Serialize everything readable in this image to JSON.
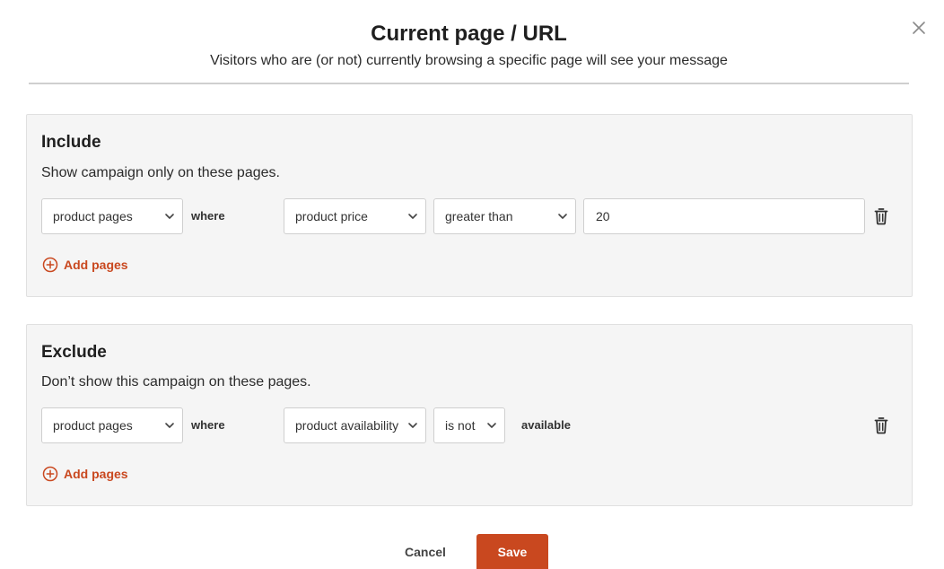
{
  "dialog": {
    "title": "Current page / URL",
    "subtitle": "Visitors who are (or not) currently browsing a specific page will see your message"
  },
  "include": {
    "title": "Include",
    "description": "Show campaign only on these pages.",
    "rule": {
      "page_type": "product pages",
      "where_label": "where",
      "attribute": "product price",
      "operator": "greater than",
      "value": "20"
    },
    "add_label": "Add pages"
  },
  "exclude": {
    "title": "Exclude",
    "description": "Don’t show this campaign on these pages.",
    "rule": {
      "page_type": "product pages",
      "where_label": "where",
      "attribute": "product availability",
      "operator": "is not",
      "value": "available"
    },
    "add_label": "Add pages"
  },
  "footer": {
    "cancel_label": "Cancel",
    "save_label": "Save"
  },
  "colors": {
    "accent": "#c9481f",
    "panel_bg": "#f5f5f5"
  },
  "icons": {
    "close": "close-icon",
    "chevron": "chevron-down-icon",
    "trash": "trash-icon",
    "add": "plus-circle-icon"
  }
}
